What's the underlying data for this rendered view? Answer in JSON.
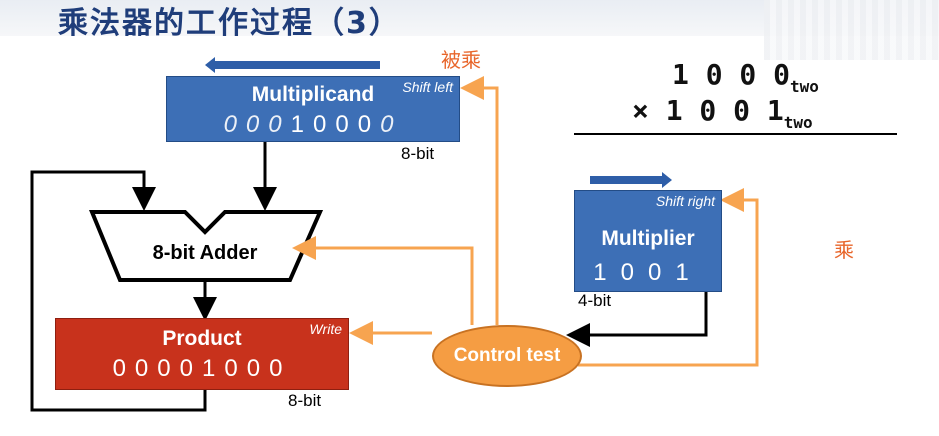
{
  "title": "乘法器的工作过程（3）",
  "labels": {
    "multiplicand_cn": "被乘",
    "multiplier_cn": "乘"
  },
  "multiplicand": {
    "name": "Multiplicand",
    "operation": "Shift left",
    "bits": [
      "0",
      "0",
      "0",
      "1",
      "0",
      "0",
      "0",
      "0"
    ],
    "width_label": "8-bit"
  },
  "adder": {
    "name": "8-bit Adder"
  },
  "product": {
    "name": "Product",
    "operation": "Write",
    "bits": [
      "0",
      "0",
      "0",
      "0",
      "1",
      "0",
      "0",
      "0"
    ],
    "width_label": "8-bit"
  },
  "multiplier": {
    "name": "Multiplier",
    "operation": "Shift right",
    "bits": [
      "1",
      "0",
      "0",
      "1"
    ],
    "width_label": "4-bit"
  },
  "control": {
    "name": "Control test"
  },
  "example": {
    "line1_digits": "1 0 0 0",
    "line1_sub": "two",
    "line2_op": "×",
    "line2_digits": "1 0 0 1",
    "line2_sub": "two"
  },
  "colors": {
    "register_blue": "#3d6fb6",
    "product_red": "#c8321c",
    "control_orange": "#f59d43",
    "arrow_orange": "#f7a450",
    "shift_arrow_blue": "#2e5ea8",
    "title_blue": "#1f3d7a"
  }
}
